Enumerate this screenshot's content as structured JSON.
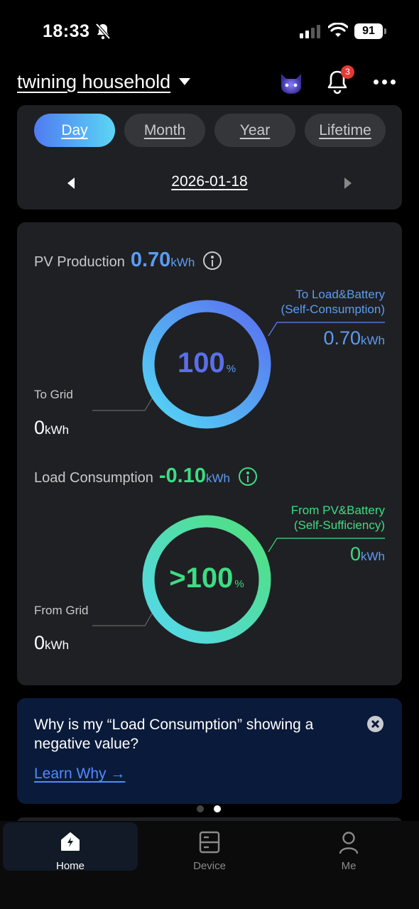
{
  "status_bar": {
    "time": "18:33",
    "battery": "91"
  },
  "header": {
    "title": "twining household",
    "notification_count": "3"
  },
  "period": {
    "tabs": [
      {
        "label": "Day",
        "active": true
      },
      {
        "label": "Month",
        "active": false
      },
      {
        "label": "Year",
        "active": false
      },
      {
        "label": "Lifetime",
        "active": false
      }
    ],
    "date": "2026-01-18"
  },
  "pv": {
    "title": "PV Production",
    "value": "0.70",
    "unit": "kWh",
    "ring_percent_text": "100",
    "ring_percent_sign": "%",
    "ring_fill": 1.0,
    "right_label_1": "To Load&Battery",
    "right_label_2": "(Self-Consumption)",
    "right_value": "0.70",
    "right_unit": "kWh",
    "left_label": "To Grid",
    "left_value": "0",
    "left_unit": "kWh",
    "color": "#5b86f3"
  },
  "load": {
    "title": "Load Consumption",
    "value": "-0.10",
    "unit": "kWh",
    "ring_percent_text": ">100",
    "ring_percent_sign": "%",
    "ring_fill": 1.0,
    "right_label_1": "From PV&Battery",
    "right_label_2": "(Self-Sufficiency)",
    "right_value": "0",
    "right_unit": "kWh",
    "left_label": "From Grid",
    "left_value": "0",
    "left_unit": "kWh",
    "color": "#3ddc84"
  },
  "banner": {
    "question": "Why is my “Load Consumption” showing a negative value?",
    "link": "Learn Why →"
  },
  "nav": {
    "home": "Home",
    "device": "Device",
    "me": "Me"
  }
}
